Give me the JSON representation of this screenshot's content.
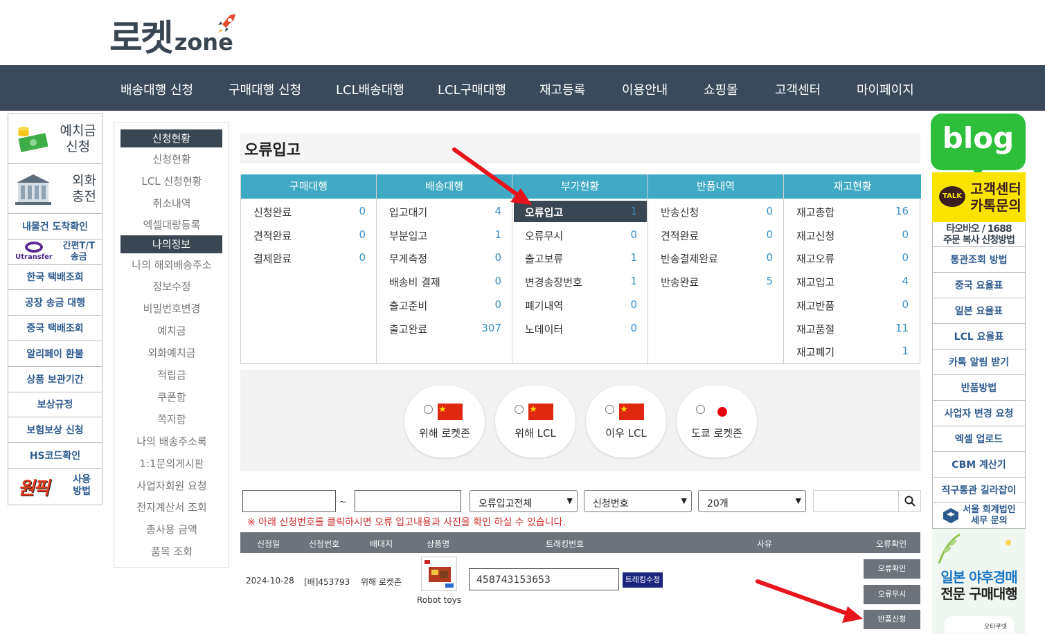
{
  "logo": {
    "korean": "로켓",
    "english": "zone"
  },
  "nav": [
    "배송대행 신청",
    "구매대행 신청",
    "LCL배송대행",
    "LCL구매대행",
    "재고등록",
    "이용안내",
    "쇼핑몰",
    "고객센터",
    "마이페이지"
  ],
  "left_menu": {
    "deposit": {
      "line1": "예치금",
      "line2": "신청"
    },
    "fx": {
      "line1": "외화",
      "line2": "충전"
    },
    "items": [
      "내물건 도착확인",
      "한국 택배조회",
      "공장 송금 대행",
      "중국 택배조회",
      "알리페이 환불",
      "상품 보관기간",
      "보상규정",
      "보험보상 신청",
      "HS코드확인"
    ],
    "utransfer": {
      "brand": "Utransfer",
      "line1": "간편T/T",
      "line2": "송금"
    },
    "wonpick": {
      "brand": "원픽",
      "line1": "사용",
      "line2": "방법"
    }
  },
  "sub_menu": {
    "section1": "신청현황",
    "items1": [
      "신청현황",
      "LCL 신청현황",
      "취소내역",
      "엑셀대량등록"
    ],
    "section2": "나의정보",
    "items2": [
      "나의 해외배송주소",
      "정보수정",
      "비밀번호변경",
      "예치금",
      "외화예치금",
      "적립금",
      "쿠폰함",
      "쪽지함",
      "나의 배송주소록",
      "1:1문의게시판",
      "사업자회원 요청",
      "전자계산서 조회",
      "총사용 금액",
      "품목 조회"
    ]
  },
  "page_title": "오류입고",
  "stats": [
    {
      "header": "구매대행",
      "rows": [
        {
          "k": "신청완료",
          "v": "0"
        },
        {
          "k": "견적완료",
          "v": "0"
        },
        {
          "k": "결제완료",
          "v": "0"
        }
      ]
    },
    {
      "header": "배송대행",
      "rows": [
        {
          "k": "입고대기",
          "v": "4"
        },
        {
          "k": "부분입고",
          "v": "1"
        },
        {
          "k": "무게측정",
          "v": "0"
        },
        {
          "k": "배송비 결제",
          "v": "0"
        },
        {
          "k": "출고준비",
          "v": "0"
        },
        {
          "k": "출고완료",
          "v": "307"
        }
      ]
    },
    {
      "header": "부가현황",
      "rows": [
        {
          "k": "오류입고",
          "v": "1"
        },
        {
          "k": "오류무시",
          "v": "0"
        },
        {
          "k": "출고보류",
          "v": "1"
        },
        {
          "k": "변경송장번호",
          "v": "1"
        },
        {
          "k": "폐기내역",
          "v": "0"
        },
        {
          "k": "노데이터",
          "v": "0"
        }
      ]
    },
    {
      "header": "반품내역",
      "rows": [
        {
          "k": "반송신청",
          "v": "0"
        },
        {
          "k": "견적완료",
          "v": "0"
        },
        {
          "k": "반송결제완료",
          "v": "0"
        },
        {
          "k": "반송완료",
          "v": "5"
        }
      ]
    },
    {
      "header": "재고현황",
      "rows": [
        {
          "k": "재고총합",
          "v": "16"
        },
        {
          "k": "재고신청",
          "v": "0"
        },
        {
          "k": "재고오류",
          "v": "0"
        },
        {
          "k": "재고입고",
          "v": "4"
        },
        {
          "k": "재고반품",
          "v": "0"
        },
        {
          "k": "재고품절",
          "v": "11"
        },
        {
          "k": "재고폐기",
          "v": "1"
        }
      ]
    }
  ],
  "carriers": [
    {
      "label": "위해 로켓존",
      "flag": "china"
    },
    {
      "label": "위해 LCL",
      "flag": "china"
    },
    {
      "label": "이우 LCL",
      "flag": "china"
    },
    {
      "label": "도쿄 로켓존",
      "flag": "japan"
    }
  ],
  "filters": {
    "tilde": "~",
    "status": "오류입고전체",
    "field": "신청번호",
    "count": "20개"
  },
  "notice": "※ 아래 신청번호를 클릭하시면 오류 입고내용과 사진을 확인 하실 수 있습니다.",
  "table": {
    "headers": [
      "신청일",
      "신청번호",
      "배대지",
      "상품명",
      "트래킹번호",
      "사유",
      "오류확인"
    ],
    "row": {
      "date": "2024-10-28",
      "no": "[배]453793",
      "dest": "위해 로켓존",
      "product": "Robot toys",
      "tracking": "458743153653",
      "tracking_btn": "트레킹수정"
    },
    "actions": [
      "오류확인",
      "오류무시",
      "반품신청"
    ]
  },
  "right_menu": {
    "blog": "blog",
    "talk": {
      "bubble": "TALK",
      "line1": "고객센터",
      "line2": "카톡문의"
    },
    "tao": {
      "line1": "타오바오 / 1688",
      "line2": "주문 복사 신청방법"
    },
    "items": [
      "통관조회 방법",
      "중국 요율표",
      "일본 요율표",
      "LCL 요율표",
      "카톡 알림 받기",
      "반품방법",
      "사업자 변경 요청",
      "엑셀 업로드",
      "CBM 계산기",
      "직구통관 길라잡이"
    ],
    "tax": {
      "line1": "서울 회계법인",
      "line2": "세무 문의"
    },
    "jp": {
      "line1": "일본 야후경매",
      "line2": "전문 구매대행",
      "badge": "오타쿠넷"
    }
  },
  "colors": {
    "nav": "#3a4a5c",
    "stat_header": "#40aac5",
    "accent": "#3a8fc7",
    "highlight": "#3a4651",
    "annotation": "#e8141b"
  }
}
